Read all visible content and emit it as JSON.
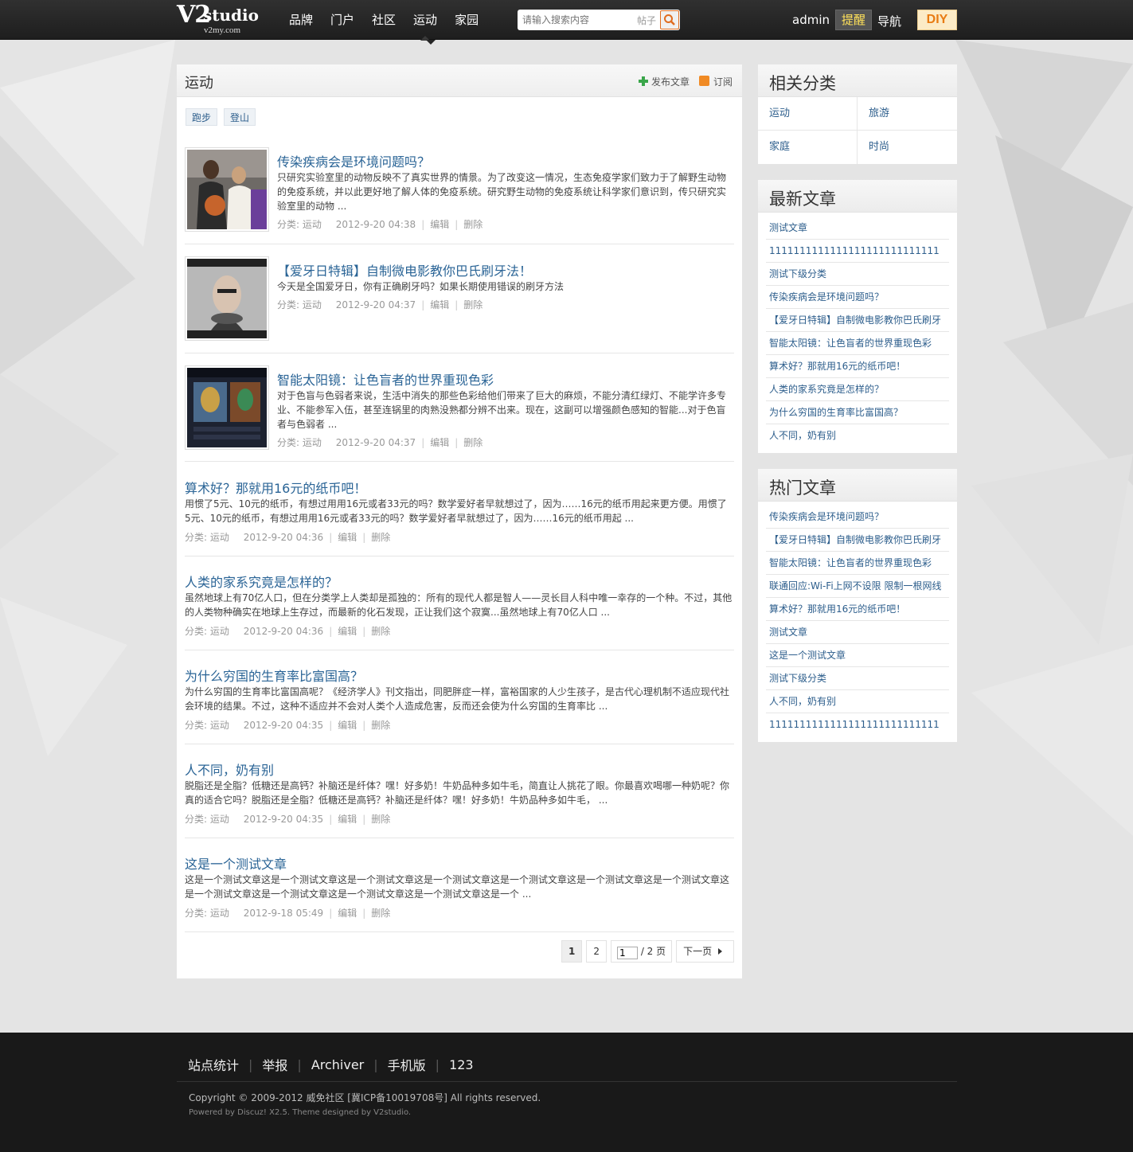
{
  "logo": {
    "main": "V2",
    "studio": "studio",
    "domain": "v2my.com"
  },
  "nav": [
    "品牌",
    "门户",
    "社区",
    "运动",
    "家园"
  ],
  "search": {
    "placeholder": "请输入搜索内容",
    "type": "帖子"
  },
  "header": {
    "user": "admin",
    "remind": "提醒",
    "guide": "导航",
    "diy": "DIY"
  },
  "main": {
    "title": "运动",
    "publish": "发布文章",
    "subscribe": "订阅",
    "tags": [
      "跑步",
      "登山"
    ],
    "articles": [
      {
        "title": "传染疾病会是环境问题吗？",
        "summary": "只研究实验室里的动物反映不了真实世界的情景。为了改变这一情况，生态免疫学家们致力于了解野生动物的免疫系统，并以此更好地了解人体的免疫系统。研究野生动物的免疫系统让科学家们意识到，传只研究实验室里的动物 ...",
        "category": "分类: 运动",
        "date": "2012-9-20 04:38",
        "edit": "编辑",
        "delete": "删除"
      },
      {
        "title": "【爱牙日特辑】自制微电影教你巴氏刷牙法！",
        "summary": "今天是全国爱牙日，你有正确刷牙吗？如果长期使用错误的刷牙方法",
        "category": "分类: 运动",
        "date": "2012-9-20 04:37",
        "edit": "编辑",
        "delete": "删除"
      },
      {
        "title": "智能太阳镜：让色盲者的世界重现色彩",
        "summary": "对于色盲与色弱者来说，生活中消失的那些色彩给他们带来了巨大的麻烦，不能分清红绿灯、不能学许多专业、不能参军入伍，甚至连锅里的肉熟没熟都分辨不出来。现在，这副可以增强颜色感知的智能...对于色盲者与色弱者 ...",
        "category": "分类: 运动",
        "date": "2012-9-20 04:37",
        "edit": "编辑",
        "delete": "删除"
      },
      {
        "title": "算术好？那就用16元的纸币吧！",
        "summary": "用惯了5元、10元的纸币，有想过用用16元或者33元的吗？数学爱好者早就想过了，因为……16元的纸币用起来更方便。用惯了5元、10元的纸币，有想过用用16元或者33元的吗？数学爱好者早就想过了，因为……16元的纸币用起 ...",
        "category": "分类: 运动",
        "date": "2012-9-20 04:36",
        "edit": "编辑",
        "delete": "删除"
      },
      {
        "title": "人类的家系究竟是怎样的？",
        "summary": "虽然地球上有70亿人口，但在分类学上人类却是孤独的：所有的现代人都是智人——灵长目人科中唯一幸存的一个种。不过，其他的人类物种确实在地球上生存过，而最新的化石发现，正让我们这个寂寞...虽然地球上有70亿人口 ...",
        "category": "分类: 运动",
        "date": "2012-9-20 04:36",
        "edit": "编辑",
        "delete": "删除"
      },
      {
        "title": "为什么穷国的生育率比富国高？",
        "summary": "为什么穷国的生育率比富国高呢？《经济学人》刊文指出，同肥胖症一样，富裕国家的人少生孩子，是古代心理机制不适应现代社会环境的结果。不过，这种不适应并不会对人类个人造成危害，反而还会使为什么穷国的生育率比 ...",
        "category": "分类: 运动",
        "date": "2012-9-20 04:35",
        "edit": "编辑",
        "delete": "删除"
      },
      {
        "title": "人不同，奶有别",
        "summary": "脱脂还是全脂？低糖还是高钙？补脑还是纤体？嘿！好多奶！牛奶品种多如牛毛，简直让人挑花了眼。你最喜欢喝哪一种奶呢？你真的适合它吗？脱脂还是全脂？低糖还是高钙？补脑还是纤体？嘿！好多奶！牛奶品种多如牛毛， ...",
        "category": "分类: 运动",
        "date": "2012-9-20 04:35",
        "edit": "编辑",
        "delete": "删除"
      },
      {
        "title": "这是一个测试文章",
        "summary": "这是一个测试文章这是一个测试文章这是一个测试文章这是一个测试文章这是一个测试文章这是一个测试文章这是一个测试文章这是一个测试文章这是一个测试文章这是一个测试文章这是一个测试文章这是一个 ...",
        "category": "分类: 运动",
        "date": "2012-9-18 05:49",
        "edit": "编辑",
        "delete": "删除"
      }
    ],
    "pager": {
      "current": "1",
      "page2": "2",
      "input": "1",
      "total": "/ 2 页",
      "next": "下一页"
    }
  },
  "sidebar": {
    "related": {
      "title": "相关分类",
      "items": [
        "运动",
        "旅游",
        "家庭",
        "时尚"
      ]
    },
    "latest": {
      "title": "最新文章",
      "items": [
        "测试文章",
        "1111111111111111111111111111",
        "测试下级分类",
        "传染疾病会是环境问题吗？",
        "【爱牙日特辑】自制微电影教你巴氏刷牙",
        "智能太阳镜：让色盲者的世界重现色彩",
        "算术好？那就用16元的纸币吧！",
        "人类的家系究竟是怎样的？",
        "为什么穷国的生育率比富国高？",
        "人不同，奶有别"
      ]
    },
    "hot": {
      "title": "热门文章",
      "items": [
        "传染疾病会是环境问题吗？",
        "【爱牙日特辑】自制微电影教你巴氏刷牙",
        "智能太阳镜：让色盲者的世界重现色彩",
        "联通回应:Wi-Fi上网不设限 限制一根网线",
        "算术好？那就用16元的纸币吧！",
        "测试文章",
        "这是一个测试文章",
        "测试下级分类",
        "人不同，奶有别",
        "1111111111111111111111111111"
      ]
    }
  },
  "footer": {
    "links": [
      "站点统计",
      "举报",
      "Archiver",
      "手机版",
      "123"
    ],
    "copyright": "Copyright © 2009-2012 威免社区 [冀ICP备10019708号] All rights reserved.",
    "powered": "Powered by Discuz! X2.5. Theme designed by V2studio."
  }
}
